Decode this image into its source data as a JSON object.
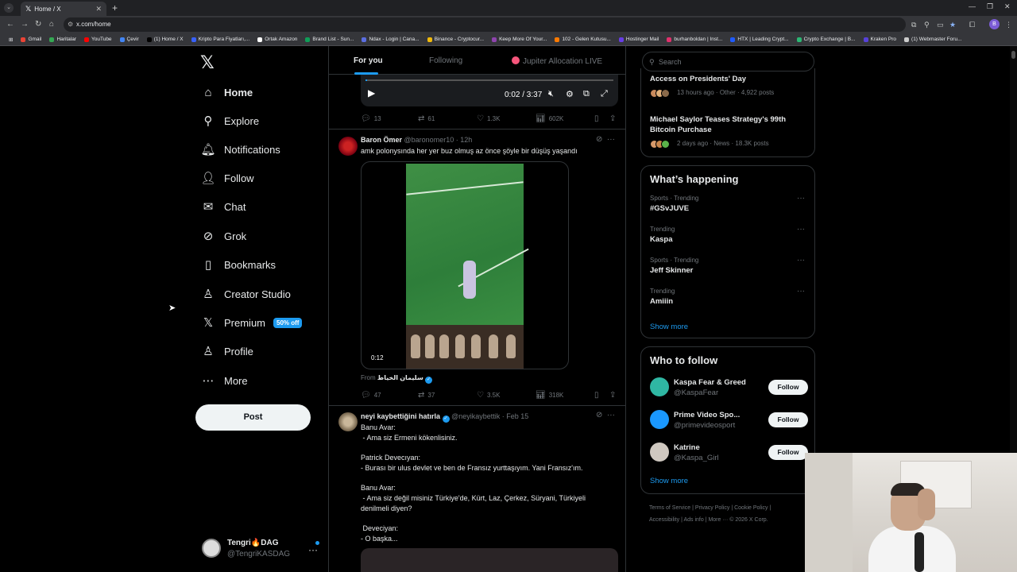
{
  "browser": {
    "tab_title": "Home / X",
    "url": "x.com/home",
    "profile_initial": "B",
    "bookmarks": [
      {
        "label": "Gmail",
        "color": "#ea4335"
      },
      {
        "label": "Haritalar",
        "color": "#34a853"
      },
      {
        "label": "YouTube",
        "color": "#ff0000"
      },
      {
        "label": "Çevir",
        "color": "#4285f4"
      },
      {
        "label": "(1) Home / X",
        "color": "#000000"
      },
      {
        "label": "Kripto Para Fiyatları,...",
        "color": "#3861fb"
      },
      {
        "label": "Ortak Amazon",
        "color": "#ffffff"
      },
      {
        "label": "Brand List - Sun...",
        "color": "#0f9d58"
      },
      {
        "label": "Ndax - Login | Cana...",
        "color": "#5b6ee1"
      },
      {
        "label": "Binance - Cryptocur...",
        "color": "#f0b90b"
      },
      {
        "label": "Keep More Of Your...",
        "color": "#8e44ad"
      },
      {
        "label": "102 - Gelen Kutusu...",
        "color": "#ff7a00"
      },
      {
        "label": "Hostinger Mail",
        "color": "#673de6"
      },
      {
        "label": "burhanboldan | Inst...",
        "color": "#e1306c"
      },
      {
        "label": "HTX | Leading Crypt...",
        "color": "#1f5bff"
      },
      {
        "label": "Crypto Exchange | B...",
        "color": "#2bb673"
      },
      {
        "label": "Kraken Pro",
        "color": "#5741d9"
      },
      {
        "label": "(1) Webmaster Foru...",
        "color": "#cccccc"
      }
    ]
  },
  "nav": {
    "items": [
      {
        "label": "Home",
        "icon": "home-icon",
        "glyph": "⌂"
      },
      {
        "label": "Explore",
        "icon": "search-icon",
        "glyph": "⚲"
      },
      {
        "label": "Notifications",
        "icon": "bell-icon",
        "glyph": "🔔︎"
      },
      {
        "label": "Follow",
        "icon": "person-plus-icon",
        "glyph": "👤︎"
      },
      {
        "label": "Chat",
        "icon": "mail-icon",
        "glyph": "✉"
      },
      {
        "label": "Grok",
        "icon": "grok-icon",
        "glyph": "⊘"
      },
      {
        "label": "Bookmarks",
        "icon": "bookmark-icon",
        "glyph": "▯"
      },
      {
        "label": "Creator Studio",
        "icon": "flask-icon",
        "glyph": "♙"
      },
      {
        "label": "Premium",
        "icon": "x-premium-icon",
        "glyph": "𝕏"
      },
      {
        "label": "Profile",
        "icon": "person-icon",
        "glyph": "♙"
      },
      {
        "label": "More",
        "icon": "more-circle-icon",
        "glyph": "⋯"
      }
    ],
    "premium_badge": "50% off",
    "post_label": "Post",
    "account": {
      "name": "Tengri🔥DAG",
      "handle": "@TengriKASDAG"
    }
  },
  "timeline": {
    "tabs": {
      "for_you": "For you",
      "following": "Following",
      "jupiter": "Jupiter Allocation LIVE"
    },
    "video": {
      "time": "0:02 / 3:37"
    },
    "tweet0_actions": {
      "replies": "13",
      "reposts": "61",
      "likes": "1.3K",
      "views": "602K"
    },
    "tweet1": {
      "name": "Baron Ömer",
      "handle": "@baronomer10 · 12h",
      "text": "amk polonysında her yer buz olmuş az önce şöyle bir düşüş yaşandı",
      "video_time": "0:12",
      "from_prefix": "From",
      "from_name": "سليمان الخياط",
      "replies": "47",
      "reposts": "37",
      "likes": "3.5K",
      "views": "318K"
    },
    "tweet2": {
      "name": "neyi kaybettiğini hatırla",
      "handle": "@neyikaybettik · Feb 15",
      "text": "Banu Avar:\n - Ama siz Ermeni kökenlisiniz.\n\nPatrick Devecıyan:\n- Burası bir ulus devlet ve ben de Fransız yurttaşıyım. Yani Fransız'ım.\n\nBanu Avar:\n - Ama siz değil misiniz Türkiye'de, Kürt, Laz, Çerkez, Süryani, Türkiyeli denilmeli diyen?\n\n Deveciyan:\n- O başka..."
    }
  },
  "sidebar": {
    "search_placeholder": "Search",
    "news": [
      {
        "title": "Access on Presidents' Day",
        "meta": "13 hours ago · Other · 4,922 posts"
      },
      {
        "title": "Michael Saylor Teases Strategy's 99th Bitcoin Purchase",
        "meta": "2 days ago · News · 18.3K posts"
      }
    ],
    "happening_title": "What’s happening",
    "trends": [
      {
        "context": "Sports · Trending",
        "name": "#GSvJUVE"
      },
      {
        "context": "Trending",
        "name": "Kaspa"
      },
      {
        "context": "Sports · Trending",
        "name": "Jeff Skinner"
      },
      {
        "context": "Trending",
        "name": "Amiiin"
      }
    ],
    "show_more": "Show more",
    "wtf_title": "Who to follow",
    "who_to_follow": [
      {
        "name": "Kaspa Fear & Greed",
        "handle": "@KaspaFear",
        "avatar_color": "#2fb7a3"
      },
      {
        "name": "Prime Video Spo...",
        "handle": "@primevideosport",
        "avatar_color": "#1a98ff"
      },
      {
        "name": "Katrine",
        "handle": "@Kaspa_Girl",
        "avatar_color": "#cfc8c0"
      }
    ],
    "follow_label": "Follow",
    "footer_line1": "Terms of Service  |  Privacy Policy  |  Cookie Policy  |",
    "footer_line2": "Accessibility  |  Ads info  |  More ···  © 2026 X Corp."
  }
}
